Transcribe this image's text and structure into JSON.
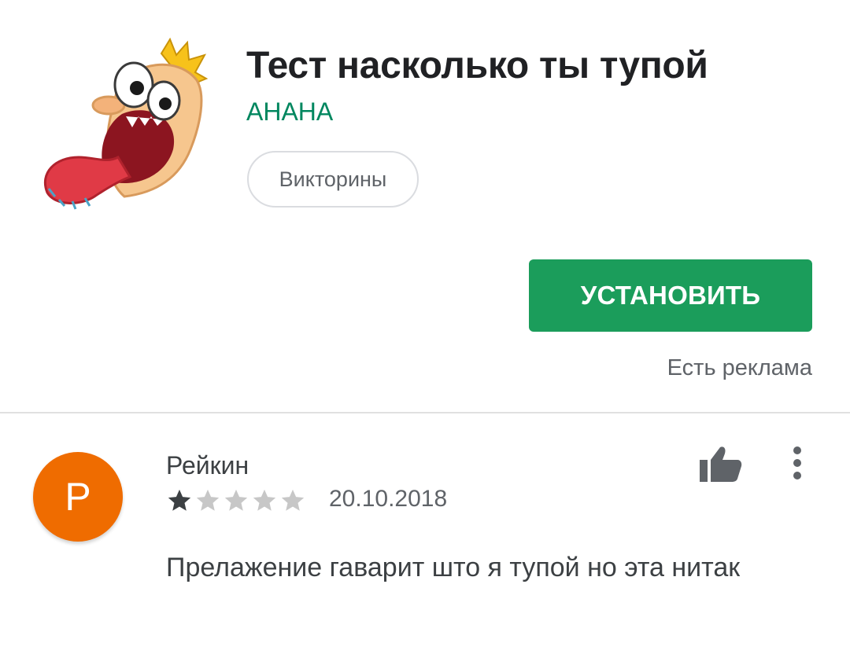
{
  "app": {
    "title": "Тест насколько ты тупой",
    "developer": "АНАНА",
    "category": "Викторины",
    "install_label": "УСТАНОВИТЬ",
    "ads_note": "Есть реклама",
    "icon": "screaming-cartoon-face-icon"
  },
  "review": {
    "avatar_letter": "Р",
    "author": "Рейкин",
    "rating": 1,
    "rating_max": 5,
    "date": "20.10.2018",
    "text": "Прелажение гаварит што я тупой но эта нитак",
    "icons": [
      "thumbs-up-icon",
      "more-vert-icon"
    ]
  },
  "colors": {
    "accent_green": "#1b9d5b",
    "developer_green": "#01875f",
    "avatar_orange": "#ef6c00",
    "star_filled": "#3c4043",
    "star_empty": "#c7c7c7"
  }
}
